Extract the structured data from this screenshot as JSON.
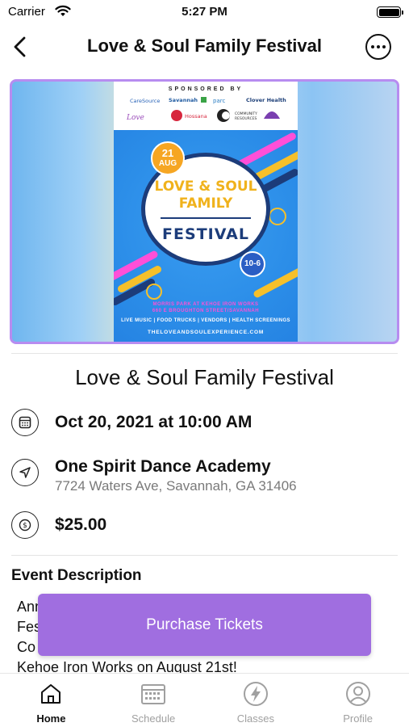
{
  "status_bar": {
    "carrier": "Carrier",
    "time": "5:27 PM"
  },
  "nav": {
    "title": "Love & Soul Family Festival"
  },
  "poster": {
    "sponsored_by": "SPONSORED BY",
    "sponsors": [
      "CareSource",
      "Savannah",
      "parc",
      "Clover Health",
      "Hossana",
      "Community Resources"
    ],
    "date_day": "21",
    "date_month": "AUG",
    "title_line1": "LOVE & SOUL",
    "title_line2": "FAMILY",
    "title_line3": "FESTIVAL",
    "hours": "10-6",
    "venue_line1": "MORRIS PARK AT KEHOE IRON WORKS",
    "venue_line2": "660 E BROUGHTON STREET/SAVANNAH",
    "amenities": "LIVE MUSIC | FOOD TRUCKS | VENDORS | HEALTH SCREENINGS",
    "website": "THELOVEANDSOULEXPERIENCE.COM"
  },
  "event": {
    "title": "Love & Soul Family Festival",
    "datetime": "Oct 20, 2021 at 10:00 AM",
    "venue_name": "One Spirit Dance Academy",
    "venue_address": "7724 Waters Ave, Savannah, GA 31406",
    "price": "$25.00",
    "description_heading": "Event Description",
    "description_lines": [
      "Ann",
      "Fes",
      "Co",
      "Kehoe Iron Works on August 21st!"
    ]
  },
  "purchase_button": {
    "label": "Purchase Tickets",
    "color": "#a06ee0"
  },
  "tab_bar": {
    "items": [
      {
        "label": "Home",
        "icon": "home-icon",
        "active": true
      },
      {
        "label": "Schedule",
        "icon": "calendar-icon",
        "active": false
      },
      {
        "label": "Classes",
        "icon": "lightning-icon",
        "active": false
      },
      {
        "label": "Profile",
        "icon": "profile-icon",
        "active": false
      }
    ]
  },
  "colors": {
    "accent": "#a06ee0",
    "banner_border": "#b78cf0",
    "muted_text": "#7a7a7a"
  }
}
